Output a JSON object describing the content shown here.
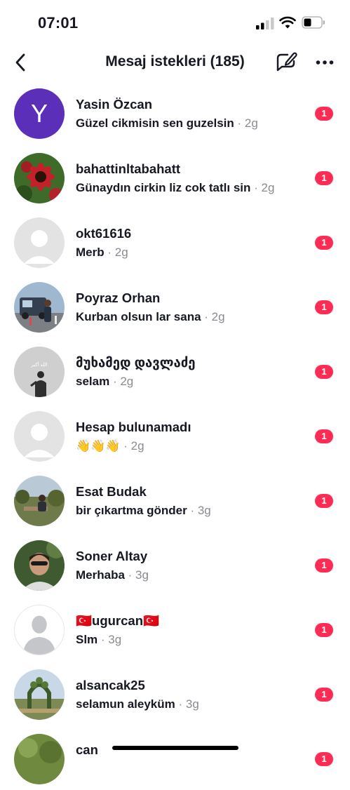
{
  "status_bar": {
    "time": "07:01"
  },
  "header": {
    "title": "Mesaj istekleri (185)"
  },
  "requests": [
    {
      "name": "Yasin Özcan",
      "message": "Güzel cikmisin sen guzelsin",
      "time": "· 2g",
      "badge": "1",
      "avatar_letter": "Y",
      "avatar_color": "#5b2fb8"
    },
    {
      "name": "bahattinltabahatt",
      "message": "Günaydın cirkin liz cok tatlı sin",
      "time": "· 2g",
      "badge": "1"
    },
    {
      "name": "okt61616",
      "message": "Merb",
      "time": "· 2g",
      "badge": "1"
    },
    {
      "name": "Poyraz Orhan",
      "message": "Kurban olsun lar sana",
      "time": "· 2g",
      "badge": "1"
    },
    {
      "name": "მუხამედ დავლაძე",
      "message": "selam",
      "time": "· 2g",
      "badge": "1",
      "avatar_text": "الله أكبر"
    },
    {
      "name": "Hesap bulunamadı",
      "message": "👋👋👋",
      "time": "· 2g",
      "badge": "1"
    },
    {
      "name": "Esat Budak",
      "message": "bir çıkartma gönder",
      "time": "· 3g",
      "badge": "1"
    },
    {
      "name": "Soner Altay",
      "message": "Merhaba",
      "time": "· 3g",
      "badge": "1"
    },
    {
      "name": "🇹🇷ugurcan🇹🇷",
      "message": "Slm",
      "time": "· 3g",
      "badge": "1"
    },
    {
      "name": "alsancak25",
      "message": "selamun aleyküm",
      "time": "· 3g",
      "badge": "1"
    },
    {
      "name": "can",
      "message": "",
      "time": "",
      "badge": "1"
    }
  ],
  "colors": {
    "badge": "#fe2c55",
    "muted_text": "#8a8b91",
    "primary_text": "#161823"
  },
  "icons": {
    "back": "chevron-left-icon",
    "compose": "compose-message-icon",
    "more": "more-horizontal-icon"
  }
}
